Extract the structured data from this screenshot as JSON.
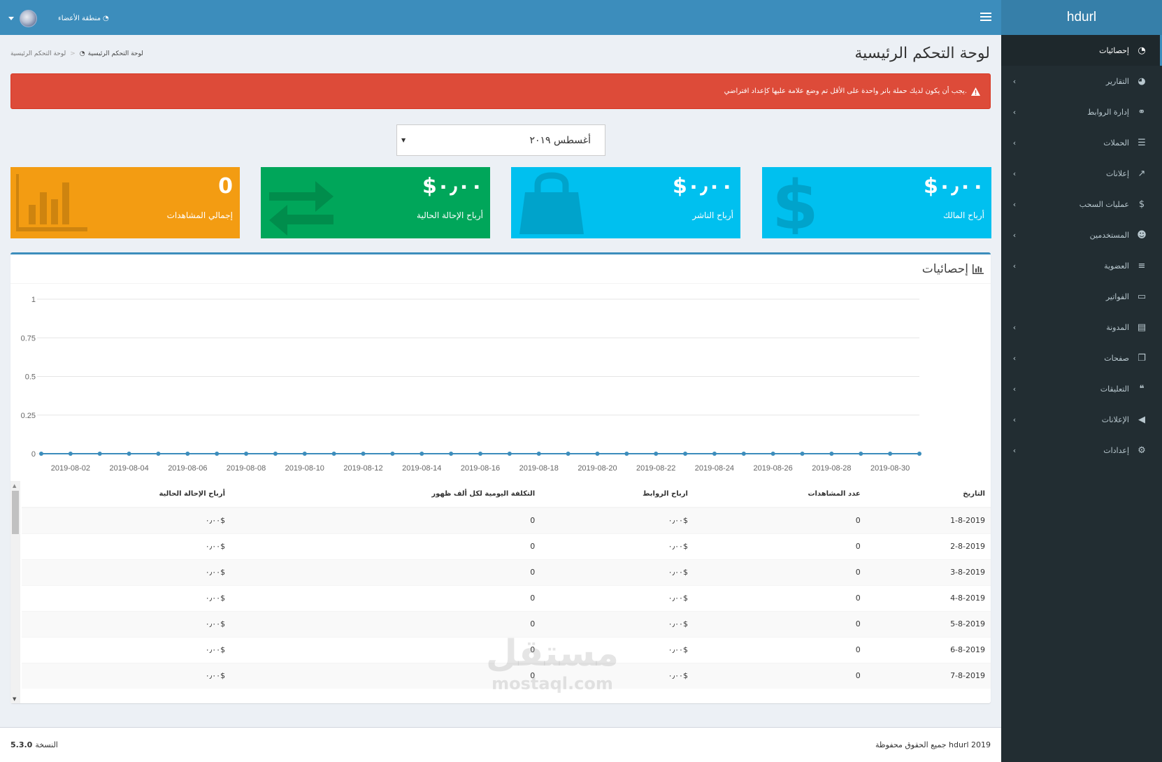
{
  "brand": "hdurl",
  "header": {
    "user_label": "منطقة الأعضاء"
  },
  "sidebar": {
    "items": [
      {
        "label": "إحصائيات",
        "icon": "dashboard-icon",
        "glyph": "◔",
        "active": true,
        "chevron": false
      },
      {
        "label": "التقارير",
        "icon": "pie-chart-icon",
        "glyph": "◕",
        "active": false,
        "chevron": true
      },
      {
        "label": "إدارة الروابط",
        "icon": "link-icon",
        "glyph": "⚭",
        "active": false,
        "chevron": true
      },
      {
        "label": "الحملات",
        "icon": "database-icon",
        "glyph": "☰",
        "active": false,
        "chevron": true
      },
      {
        "label": "إعلانات",
        "icon": "line-chart-icon",
        "glyph": "↗",
        "active": false,
        "chevron": true
      },
      {
        "label": "عمليات السحب",
        "icon": "dollar-icon",
        "glyph": "$",
        "active": false,
        "chevron": true
      },
      {
        "label": "المستخدمين",
        "icon": "users-icon",
        "glyph": "☻",
        "active": false,
        "chevron": true
      },
      {
        "label": "العضوية",
        "icon": "bars-icon",
        "glyph": "≡",
        "active": false,
        "chevron": true
      },
      {
        "label": "الفواتير",
        "icon": "credit-card-icon",
        "glyph": "▭",
        "active": false,
        "chevron": false
      },
      {
        "label": "المدونة",
        "icon": "file-text-icon",
        "glyph": "▤",
        "active": false,
        "chevron": true
      },
      {
        "label": "صفحات",
        "icon": "copy-icon",
        "glyph": "❐",
        "active": false,
        "chevron": true
      },
      {
        "label": "التعليقات",
        "icon": "quote-icon",
        "glyph": "❝",
        "active": false,
        "chevron": true
      },
      {
        "label": "الإعلانات",
        "icon": "bullhorn-icon",
        "glyph": "◀",
        "active": false,
        "chevron": true
      },
      {
        "label": "إعدادات",
        "icon": "cogs-icon",
        "glyph": "⚙",
        "active": false,
        "chevron": true
      }
    ]
  },
  "page": {
    "title": "لوحة التحكم الرئيسية",
    "breadcrumb": {
      "home": "لوحة التحكم الرئيسية",
      "current": "لوحة التحكم الرئيسية",
      "separator": ">"
    },
    "alert": "يجب أن يكون لديك حملة بانر واحدة على الأقل تم وضع علامة عليها كإعداد افتراضي.",
    "month_select": "أغسطس ٢٠١٩"
  },
  "tiles": [
    {
      "value": "$٠٫٠٠",
      "label": "أرباح المالك",
      "icon": "dollar-icon"
    },
    {
      "value": "$٠٫٠٠",
      "label": "أرباح الناشر",
      "icon": "shopping-bag-icon"
    },
    {
      "value": "$٠٫٠٠",
      "label": "أرباح الإحالة الحالية",
      "icon": "exchange-icon"
    },
    {
      "value": "0",
      "label": "إجمالي المشاهدات",
      "icon": "bar-chart-icon"
    }
  ],
  "stats_box": {
    "title": "إحصائيات"
  },
  "chart_data": {
    "type": "line",
    "x": [
      "2019-08-01",
      "2019-08-02",
      "2019-08-03",
      "2019-08-04",
      "2019-08-05",
      "2019-08-06",
      "2019-08-07",
      "2019-08-08",
      "2019-08-09",
      "2019-08-10",
      "2019-08-11",
      "2019-08-12",
      "2019-08-13",
      "2019-08-14",
      "2019-08-15",
      "2019-08-16",
      "2019-08-17",
      "2019-08-18",
      "2019-08-19",
      "2019-08-20",
      "2019-08-21",
      "2019-08-22",
      "2019-08-23",
      "2019-08-24",
      "2019-08-25",
      "2019-08-26",
      "2019-08-27",
      "2019-08-28",
      "2019-08-29",
      "2019-08-30",
      "2019-08-31"
    ],
    "x_tick_labels": [
      "2019-08-02",
      "2019-08-04",
      "2019-08-06",
      "2019-08-08",
      "2019-08-10",
      "2019-08-12",
      "2019-08-14",
      "2019-08-16",
      "2019-08-18",
      "2019-08-20",
      "2019-08-22",
      "2019-08-24",
      "2019-08-26",
      "2019-08-28",
      "2019-08-30"
    ],
    "series": [
      {
        "values": [
          0,
          0,
          0,
          0,
          0,
          0,
          0,
          0,
          0,
          0,
          0,
          0,
          0,
          0,
          0,
          0,
          0,
          0,
          0,
          0,
          0,
          0,
          0,
          0,
          0,
          0,
          0,
          0,
          0,
          0,
          0
        ],
        "color": "#3c8dbc"
      }
    ],
    "y_ticks": [
      "0",
      "0.25",
      "0.5",
      "0.75",
      "1"
    ],
    "ylim": [
      0,
      1
    ],
    "grid": true
  },
  "table": {
    "headers": [
      "التاريخ",
      "عدد المشاهدات",
      "ارباح الروابط",
      "التكلفة اليومية لكل ألف ظهور",
      "أرباح الإحالة الحالية"
    ],
    "rows": [
      [
        "1-8-2019",
        "0",
        "$٠٫٠٠",
        "0",
        "$٠٫٠٠"
      ],
      [
        "2-8-2019",
        "0",
        "$٠٫٠٠",
        "0",
        "$٠٫٠٠"
      ],
      [
        "3-8-2019",
        "0",
        "$٠٫٠٠",
        "0",
        "$٠٫٠٠"
      ],
      [
        "4-8-2019",
        "0",
        "$٠٫٠٠",
        "0",
        "$٠٫٠٠"
      ],
      [
        "5-8-2019",
        "0",
        "$٠٫٠٠",
        "0",
        "$٠٫٠٠"
      ],
      [
        "6-8-2019",
        "0",
        "$٠٫٠٠",
        "0",
        "$٠٫٠٠"
      ],
      [
        "7-8-2019",
        "0",
        "$٠٫٠٠",
        "0",
        "$٠٫٠٠"
      ]
    ]
  },
  "footer": {
    "copyright": "جميع الحقوق محفوظة hdurl 2019",
    "version_label": "النسخة",
    "version": "5.3.0"
  },
  "watermark": {
    "arabic": "مستقل",
    "latin": "mostaql.com"
  },
  "colors": {
    "header": "#3c8dbc",
    "sidebar": "#222d32",
    "alert": "#dd4b39",
    "aqua": "#00c0ef",
    "green": "#00a65a",
    "orange": "#f39c12"
  }
}
